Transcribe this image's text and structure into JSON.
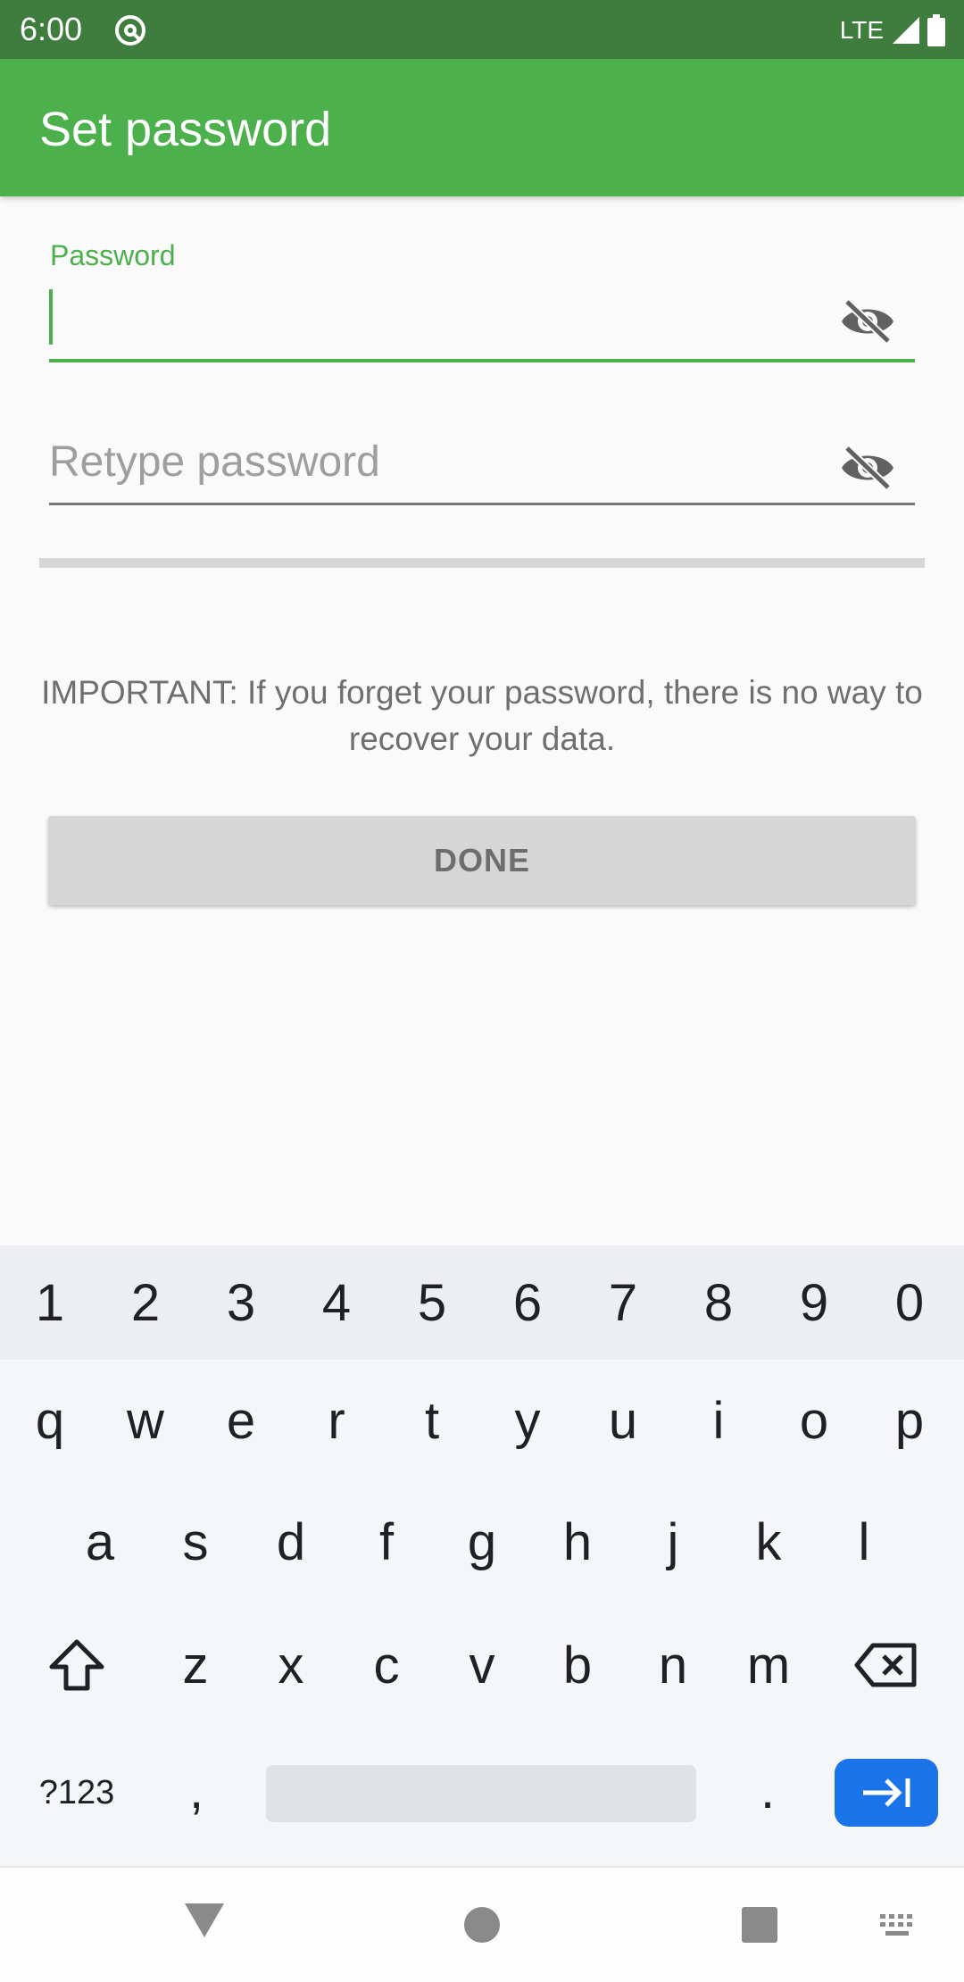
{
  "status_bar": {
    "time": "6:00",
    "network": "LTE"
  },
  "app_bar": {
    "title": "Set password"
  },
  "form": {
    "password_label": "Password",
    "retype_placeholder": "Retype password",
    "notice": "IMPORTANT: If you forget your password, there is no way to recover your data.",
    "done_label": "DONE"
  },
  "keyboard": {
    "numbers": [
      "1",
      "2",
      "3",
      "4",
      "5",
      "6",
      "7",
      "8",
      "9",
      "0"
    ],
    "row1": [
      "q",
      "w",
      "e",
      "r",
      "t",
      "y",
      "u",
      "i",
      "o",
      "p"
    ],
    "row2": [
      "a",
      "s",
      "d",
      "f",
      "g",
      "h",
      "j",
      "k",
      "l"
    ],
    "row3": [
      "z",
      "x",
      "c",
      "v",
      "b",
      "n",
      "m"
    ],
    "symbols_label": "?123",
    "comma": ",",
    "period": "."
  },
  "icons": {
    "app": "at-circle-icon",
    "signal": "signal-icon",
    "battery": "battery-icon",
    "visibility_off": "eye-off-icon",
    "shift": "shift-icon",
    "backspace": "backspace-icon",
    "enter": "tab-arrow-icon",
    "back": "back-triangle-icon",
    "home": "home-circle-icon",
    "recents": "recents-square-icon",
    "keyboard": "keyboard-icon"
  },
  "colors": {
    "app_bar": "#4cb04c",
    "status_bar": "#3f7d3f",
    "accent": "#4cb04c",
    "enter_key": "#1a73e8"
  }
}
